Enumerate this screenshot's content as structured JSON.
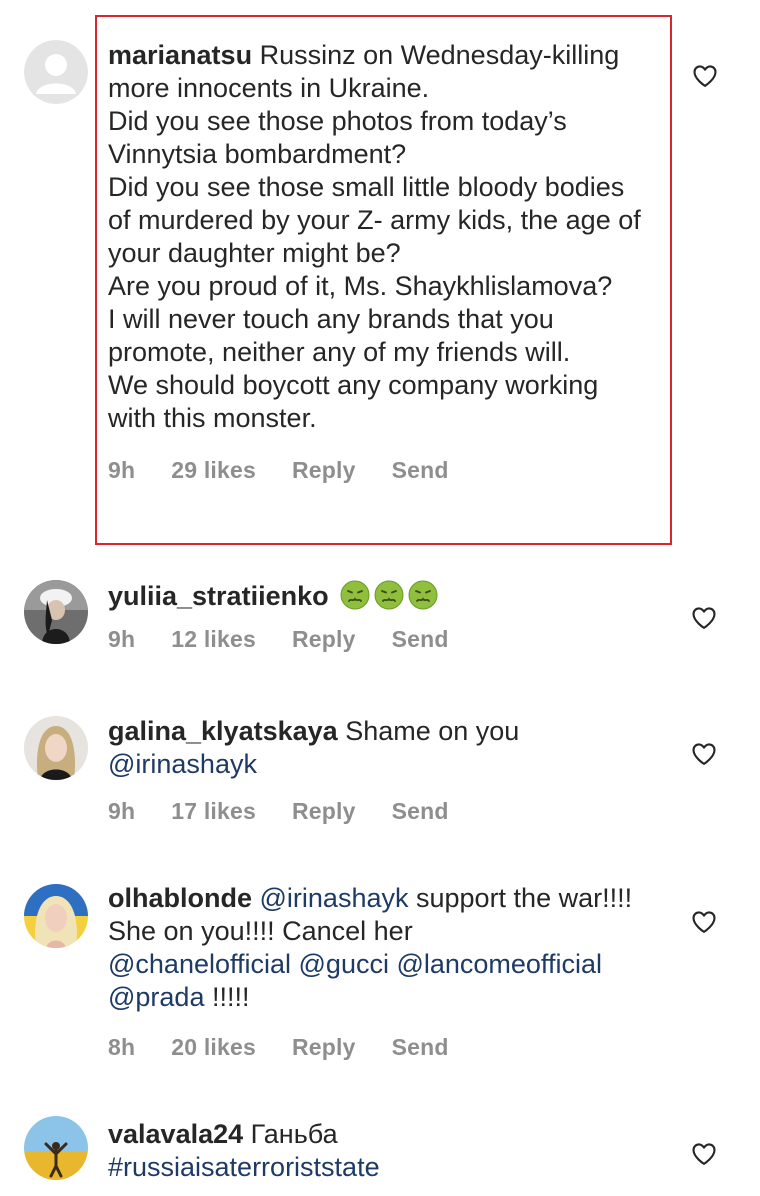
{
  "comments": [
    {
      "username": "marianatsu",
      "paragraphs": [
        "Russinz on Wednesday-killing more innocents in Ukraine.",
        "Did you see those photos from today’s Vinnytsia bombardment?",
        "Did you see those small little bloody bodies of murdered by your Z- army kids, the age of your daughter might be?",
        "Are you proud of it, Ms. Shaykhlislamova?",
        "I will never touch any brands that you promote, neither any of my friends will.",
        "We should boycott any company working with this monster."
      ],
      "time": "9h",
      "likes": "29 likes",
      "reply": "Reply",
      "send": "Send"
    },
    {
      "username": "yuliia_stratiienko",
      "emoji": [
        "nauseated-face",
        "nauseated-face",
        "nauseated-face"
      ],
      "time": "9h",
      "likes": "12 likes",
      "reply": "Reply",
      "send": "Send"
    },
    {
      "username": "galina_klyatskaya",
      "text_before": "Shame on you",
      "mention": "@irinashayk",
      "time": "9h",
      "likes": "17 likes",
      "reply": "Reply",
      "send": "Send"
    },
    {
      "username": "olhablonde",
      "mention_1": "@irinashayk",
      "text_1": "support the war!!!! She on you!!!! Cancel her",
      "mentions_2": "@chanelofficial @gucci @lancomeofficial",
      "mention_3": "@prada",
      "text_3": "!!!!!",
      "time": "8h",
      "likes": "20 likes",
      "reply": "Reply",
      "send": "Send"
    },
    {
      "username": "valavala24",
      "text": "Ганьба",
      "hashtag": "#russiaisaterroriststate"
    }
  ],
  "colors": {
    "highlight_border": "#d9262e",
    "text": "#262626",
    "meta": "#8e8e8e",
    "mention": "#1e3a66"
  }
}
